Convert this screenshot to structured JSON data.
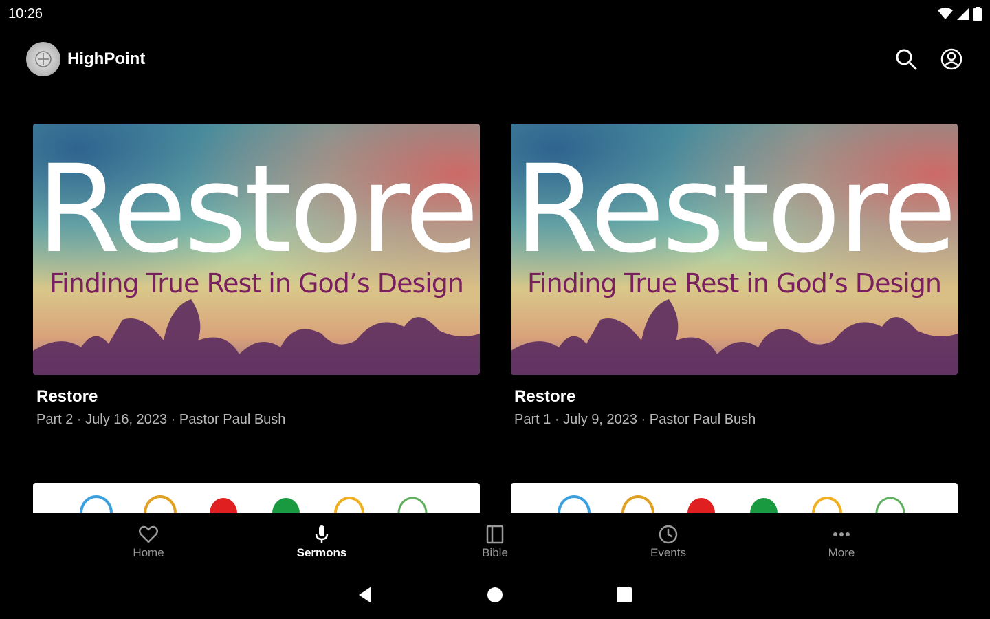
{
  "status": {
    "time": "10:26"
  },
  "app": {
    "title": "HighPoint"
  },
  "cards": [
    {
      "art_title": "Restore",
      "art_subtitle": "Finding True Rest in God’s Design",
      "title": "Restore",
      "meta": "Part 2 · July 16, 2023 · Pastor Paul Bush"
    },
    {
      "art_title": "Restore",
      "art_subtitle": "Finding True Rest in God’s Design",
      "title": "Restore",
      "meta": "Part 1 · July 9, 2023 · Pastor Paul Bush"
    }
  ],
  "nav": [
    {
      "label": "Home",
      "icon": "heart-icon"
    },
    {
      "label": "Sermons",
      "icon": "microphone-icon",
      "active": true
    },
    {
      "label": "Bible",
      "icon": "book-icon"
    },
    {
      "label": "Events",
      "icon": "clock-icon"
    },
    {
      "label": "More",
      "icon": "more-icon"
    }
  ],
  "colors": {
    "background": "#000000",
    "inactive": "#9a9a9a",
    "subtitle": "#7a2060"
  }
}
